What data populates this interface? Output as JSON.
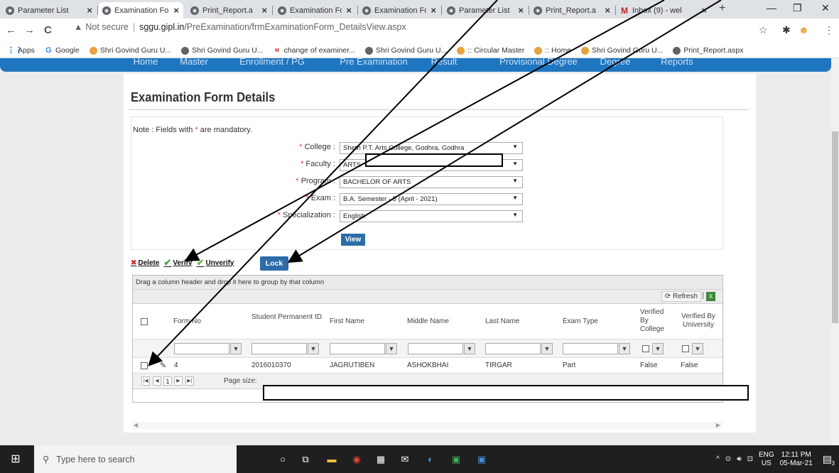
{
  "browser": {
    "tabs": [
      {
        "title": "Parameter List",
        "close": "×"
      },
      {
        "title": "Examination Fo",
        "close": "×"
      },
      {
        "title": "Print_Report.a",
        "close": "×"
      },
      {
        "title": "Examination Fo",
        "close": "×"
      },
      {
        "title": "Examination Fo",
        "close": "×"
      },
      {
        "title": "Parameter List",
        "close": "×"
      },
      {
        "title": "Print_Report.a",
        "close": "×"
      },
      {
        "title": "Inbox (9) - wel",
        "close": "×"
      }
    ],
    "new_tab": "+",
    "window_controls": {
      "minimize": "—",
      "restore": "❐",
      "close": "✕"
    },
    "nav": {
      "back": "←",
      "forward": "→",
      "reload": "C"
    },
    "address": {
      "warning_icon": "▲",
      "security_label": "Not secure",
      "separator": "|",
      "domain": "sggu.gipl.in",
      "path": "/PreExamination/frmExaminationForm_DetailsView.aspx"
    },
    "toolbar_icons": {
      "star": "☆",
      "extensions": "✱",
      "profile": "☻",
      "menu": "⋮"
    },
    "bookmarks": [
      {
        "label": "Apps",
        "icon": "apps-icon"
      },
      {
        "label": "Google",
        "icon": "google-icon"
      },
      {
        "label": "Shri Govind Guru U...",
        "icon": "university-icon"
      },
      {
        "label": "Shri Govind Guru U...",
        "icon": "globe-icon"
      },
      {
        "label": "change of examiner...",
        "icon": "gmail-icon"
      },
      {
        "label": "Shri Govind Guru U...",
        "icon": "globe-icon"
      },
      {
        "label": ":: Circular Master",
        "icon": "site-icon"
      },
      {
        "label": ":: Home",
        "icon": "site-icon"
      },
      {
        "label": "Shri Govind Guru U...",
        "icon": "university-icon"
      },
      {
        "label": "Print_Report.aspx",
        "icon": "globe-icon"
      }
    ]
  },
  "site_nav": {
    "items": [
      "Home",
      "Master",
      "Enrollment / PG",
      "Pre Examination",
      "Result",
      "Provisional Degree",
      "Degree",
      "Reports"
    ]
  },
  "page": {
    "title": "Examination Form Details",
    "note_prefix": "Note : Fields with ",
    "note_star": "*",
    "note_suffix": " are mandatory.",
    "fields": [
      {
        "label": "College :",
        "value": "Sheth P.T. Arts College, Godhra, Godhra"
      },
      {
        "label": "Faculty :",
        "value": "ARTS"
      },
      {
        "label": "Program :",
        "value": "BACHELOR OF ARTS"
      },
      {
        "label": "Exam :",
        "value": "B.A. Semester - 5 (April - 2021)"
      },
      {
        "label": "Specialization :",
        "value": "English"
      }
    ],
    "view_button": "View",
    "actions": {
      "delete": "Delete",
      "verify": "Verify",
      "unverify": "Unverify",
      "lock": "Lock"
    }
  },
  "grid": {
    "group_hint": "Drag a column header and drop it here to group by that column",
    "refresh": "Refresh",
    "separator": "|",
    "columns": [
      "Form No",
      "Student Permanent ID",
      "First Name",
      "Middle Name",
      "Last Name",
      "Exam Type",
      "Verified By College",
      "Verified By University"
    ],
    "rows": [
      {
        "form_no": "4",
        "student_id": "2016010370",
        "first_name": "JAGRUTIBEN",
        "middle_name": "ASHOKBHAI",
        "last_name": "TIRGAR",
        "exam_type": "Part",
        "verified_college": "False",
        "verified_university": "False"
      }
    ],
    "pager": {
      "current_page": "1",
      "page_size_label": "Page size:"
    }
  },
  "taskbar": {
    "search_placeholder": "Type here to search",
    "lang_top": "ENG",
    "lang_bottom": "US",
    "time": "12:11 PM",
    "date": "05-Mar-21",
    "notifications": "3"
  },
  "colors": {
    "nav_blue": "#1f76c0",
    "button_blue": "#2d6ca8",
    "required_red": "#e53935",
    "taskbar": "#1f1f1f"
  }
}
